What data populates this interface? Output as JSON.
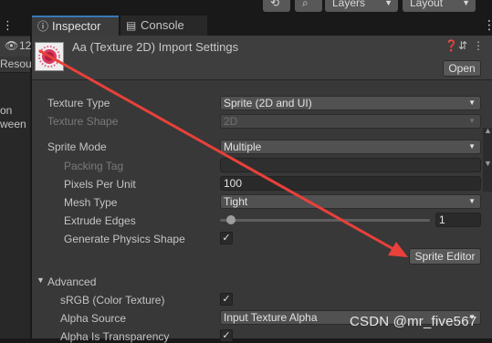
{
  "toolbar": {
    "history_icon": "history-icon",
    "search_icon": "search-icon",
    "layers_label": "Layers",
    "layout_label": "Layout"
  },
  "left_panel": {
    "visibility_count": "12",
    "tab_label": "Resou",
    "item1": "on",
    "item2": "ween"
  },
  "tabs": [
    {
      "label": "Inspector",
      "icon": "info-icon"
    },
    {
      "label": "Console",
      "icon": "console-icon"
    }
  ],
  "header": {
    "title": "Aa (Texture 2D) Import Settings",
    "open_label": "Open"
  },
  "properties": {
    "texture_type": {
      "label": "Texture Type",
      "value": "Sprite (2D and UI)"
    },
    "texture_shape": {
      "label": "Texture Shape",
      "value": "2D"
    },
    "sprite_mode": {
      "label": "Sprite Mode",
      "value": "Multiple"
    },
    "packing_tag": {
      "label": "Packing Tag",
      "value": ""
    },
    "pixels_per_unit": {
      "label": "Pixels Per Unit",
      "value": "100"
    },
    "mesh_type": {
      "label": "Mesh Type",
      "value": "Tight"
    },
    "extrude_edges": {
      "label": "Extrude Edges",
      "value": "1"
    },
    "generate_physics_shape": {
      "label": "Generate Physics Shape",
      "checked": true
    }
  },
  "sprite_editor_label": "Sprite Editor",
  "advanced": {
    "label": "Advanced",
    "srgb": {
      "label": "sRGB (Color Texture)",
      "checked": true
    },
    "alpha_source": {
      "label": "Alpha Source",
      "value": "Input Texture Alpha"
    },
    "alpha_is_transparency": {
      "label": "Alpha Is Transparency",
      "checked": true
    }
  },
  "watermark": "CSDN @mr_five567",
  "colors": {
    "arrow": "#e8413a",
    "tab_accent": "#3a79bb",
    "panel": "#383838"
  }
}
